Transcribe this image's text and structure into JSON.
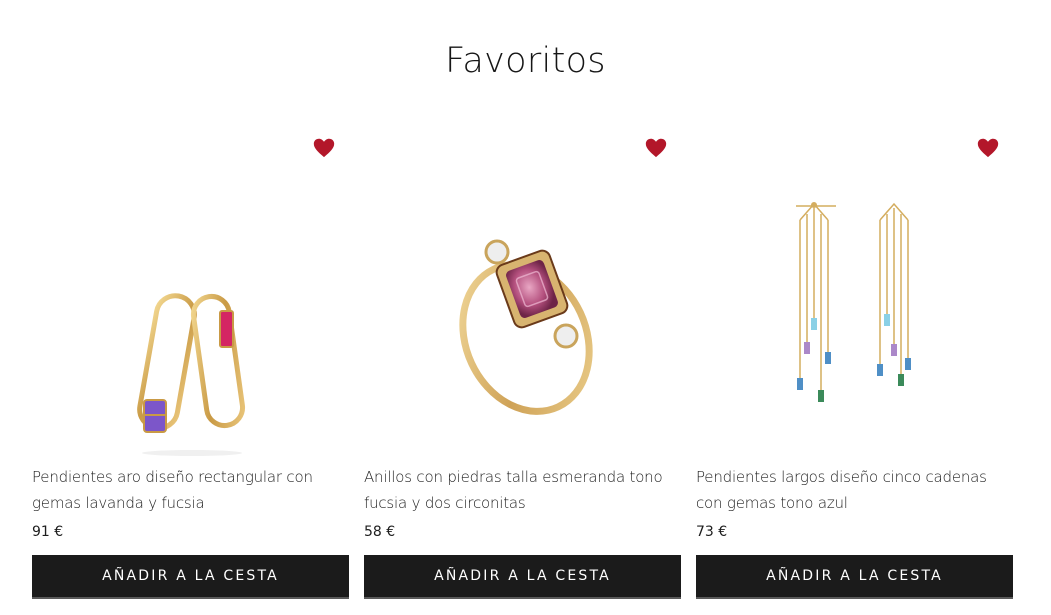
{
  "page": {
    "title": "Favoritos"
  },
  "colors": {
    "heart": "#b3172a",
    "button_bg": "#1b1b1b",
    "button_text": "#ffffff"
  },
  "products": [
    {
      "name": "Pendientes aro diseño rectangular con gemas lavanda y fucsia",
      "price": "91 €",
      "button_label": "AÑADIR A LA CESTA",
      "favorite_icon": "heart-icon",
      "image": "rectangular-hoop-earrings"
    },
    {
      "name": "Anillos con piedras talla esmeranda tono fucsia y dos circonitas",
      "price": "58 €",
      "button_label": "AÑADIR A LA CESTA",
      "favorite_icon": "heart-icon",
      "image": "emerald-cut-ring"
    },
    {
      "name": "Pendientes largos diseño cinco cadenas con gemas tono azul",
      "price": "73 €",
      "button_label": "AÑADIR A LA CESTA",
      "favorite_icon": "heart-icon",
      "image": "chain-drop-earrings"
    }
  ]
}
